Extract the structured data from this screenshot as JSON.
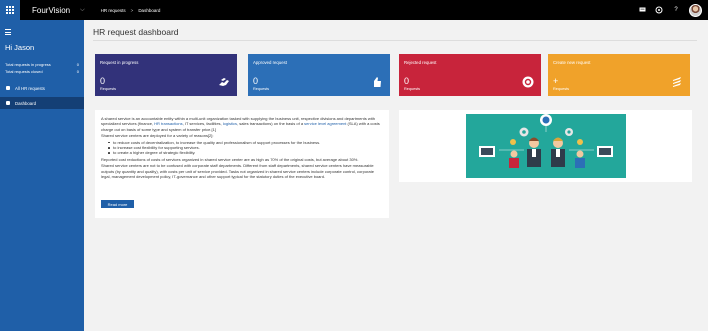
{
  "app": {
    "brand": "FourVision"
  },
  "breadcrumb": {
    "items": [
      "HR requests",
      "Dashboard"
    ],
    "separator": ">"
  },
  "sidebar": {
    "greeting": "Hi Jason",
    "stats": [
      {
        "label": "Total requests in progress",
        "value": "0"
      },
      {
        "label": "Total requests closed",
        "value": "0"
      }
    ],
    "items": [
      {
        "label": "All HR requests",
        "icon": "document-icon",
        "active": false
      },
      {
        "label": "Dashboard",
        "icon": "dashboard-icon",
        "active": true
      }
    ]
  },
  "page": {
    "title": "HR request dashboard"
  },
  "tiles": [
    {
      "title": "Request in progress",
      "value": "0",
      "sub": "Requests",
      "color": "#32327a",
      "icon": "handshake-icon"
    },
    {
      "title": "Approved request",
      "value": "0",
      "sub": "Requests",
      "color": "#2c6fb7",
      "icon": "thumbs-up-icon"
    },
    {
      "title": "Rejected request",
      "value": "0",
      "sub": "Requests",
      "color": "#c8243b",
      "icon": "reject-icon"
    },
    {
      "title": "Create new request",
      "value": "+",
      "sub": "Requests",
      "color": "#f0a22a",
      "icon": "layers-icon"
    }
  ],
  "description": {
    "p1_a": "A shared service is an accountable entity within a multi-unit organization tasked with supplying the business unit, respective divisions and departments with specialized services (finance, ",
    "p1_link1": "HR transactions",
    "p1_b": ", IT services, facilities, ",
    "p1_link2": "logistics",
    "p1_c": ", sales transactions) on the basis of a ",
    "p1_link3": "service level agreement",
    "p1_d": " (SLA) with a costs charge out on basis of some type and system of transfer price.[1]",
    "p2": "Shared service centers are deployed for a variety of reasons[2]:",
    "bullets": [
      "to reduce costs of decentralization, to increase the quality and professionalism of support processes for the business.",
      "to increase cost flexibility for supporting services.",
      "to create a higher degree of strategic flexibility."
    ],
    "p3": "Reported cost reductions of costs of services organized in shared service center are as high as 70% of the original costs, but average about 30%.",
    "p4": "Shared service centers are not to be confused with corporate staff departments. Different from staff departments, shared service centers have measurable outputs (by quantity and quality), with costs per unit of service provided. Tasks not organized in shared service centers include corporate control, corporate legal, management development policy, IT-governance and other support typical for the statutory duties of the executive board.",
    "button": "Read more"
  },
  "colors": {
    "brand": "#1f5fa8",
    "topbar": "#000000",
    "illustration_bg": "#23a79b"
  }
}
